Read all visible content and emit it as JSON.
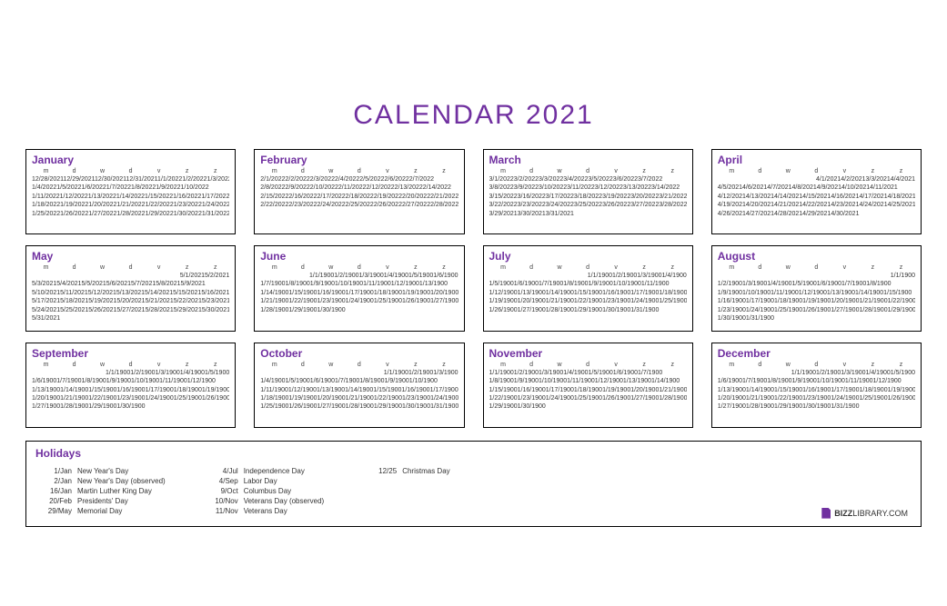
{
  "title": "CALENDAR 2021",
  "dayHeaders": [
    "m",
    "d",
    "w",
    "d",
    "v",
    "z",
    "z"
  ],
  "months": [
    {
      "name": "January",
      "rows": [
        "12/28/202112/29/202112/30/202112/31/20211/1/20221/2/20221/3/2022",
        "1/4/20221/5/20221/6/20221/7/20221/8/20221/9/20221/10/2022",
        "1/11/20221/12/20221/13/20221/14/20221/15/20221/16/20221/17/2022",
        "1/18/20221/19/20221/20/20221/21/20221/22/20221/23/20221/24/2022",
        "1/25/20221/26/20221/27/20221/28/20221/29/20221/30/20221/31/2022"
      ]
    },
    {
      "name": "February",
      "rows": [
        "2/1/20222/2/20222/3/20222/4/20222/5/20222/6/20222/7/2022",
        "2/8/20222/9/20222/10/20222/11/20222/12/20222/13/20222/14/2022",
        "2/15/20222/16/20222/17/20222/18/20222/19/20222/20/20222/21/2022",
        "2/22/20222/23/20222/24/20222/25/20222/26/20222/27/20222/28/2022"
      ]
    },
    {
      "name": "March",
      "rows": [
        "3/1/20223/2/20223/3/20223/4/20223/5/20223/6/20223/7/2022",
        "3/8/20223/9/20223/10/20223/11/20223/12/20223/13/20223/14/2022",
        "3/15/20223/16/20223/17/20223/18/20223/19/20223/20/20223/21/2022",
        "3/22/20223/23/20223/24/20223/25/20223/26/20223/27/20223/28/2022",
        "3/29/20213/30/20213/31/2021"
      ]
    },
    {
      "name": "April",
      "rows": [
        "4/1/20214/2/20213/3/20214/4/2021",
        "4/5/20214/6/20214/7/20214/8/20214/9/20214/10/20214/11/2021",
        "4/12/20214/13/20214/14/20214/15/20214/16/20214/17/20214/18/2021",
        "4/19/20214/20/20214/21/20214/22/20214/23/20214/24/20214/25/2021",
        "4/26/20214/27/20214/28/20214/29/20214/30/2021"
      ],
      "firstRowOffset": 3
    },
    {
      "name": "May",
      "rows": [
        "5/1/20215/2/2021",
        "5/3/20215/4/20215/5/20215/6/20215/7/20215/8/20215/9/2021",
        "5/10/20215/11/20215/12/20215/13/20215/14/20215/15/20215/16/2021",
        "5/17/20215/18/20215/19/20215/20/20215/21/20215/22/20215/23/2021",
        "5/24/20215/25/20215/26/20215/27/20215/28/20215/29/20215/30/2021",
        "5/31/2021"
      ],
      "firstRowOffset": 5
    },
    {
      "name": "June",
      "rows": [
        "1/1/19001/2/19001/3/19001/4/19001/5/19001/6/1900",
        "1/7/19001/8/19001/9/19001/10/19001/11/19001/12/19001/13/1900",
        "1/14/19001/15/19001/16/19001/17/19001/18/19001/19/19001/20/1900",
        "1/21/19001/22/19001/23/19001/24/19001/25/19001/26/19001/27/1900",
        "1/28/19001/29/19001/30/1900"
      ],
      "firstRowOffset": 1
    },
    {
      "name": "July",
      "rows": [
        "1/1/19001/2/19001/3/19001/4/1900",
        "1/5/19001/6/19001/7/19001/8/19001/9/19001/10/19001/11/1900",
        "1/12/19001/13/19001/14/19001/15/19001/16/19001/17/19001/18/1900",
        "1/19/19001/20/19001/21/19001/22/19001/23/19001/24/19001/25/1900",
        "1/26/19001/27/19001/28/19001/29/19001/30/19001/31/1900"
      ],
      "firstRowOffset": 3
    },
    {
      "name": "August",
      "rows": [
        "1/1/1900",
        "1/2/19001/3/19001/4/19001/5/19001/6/19001/7/19001/8/1900",
        "1/9/19001/10/19001/11/19001/12/19001/13/19001/14/19001/15/1900",
        "1/16/19001/17/19001/18/19001/19/19001/20/19001/21/19001/22/1900",
        "1/23/19001/24/19001/25/19001/26/19001/27/19001/28/19001/29/1900",
        "1/30/19001/31/1900"
      ],
      "firstRowOffset": 6
    },
    {
      "name": "September",
      "rows": [
        "1/1/19001/2/19001/3/19001/4/19001/5/1900",
        "1/6/19001/7/19001/8/19001/9/19001/10/19001/11/19001/12/1900",
        "1/13/19001/14/19001/15/19001/16/19001/17/19001/18/19001/19/1900",
        "1/20/19001/21/19001/22/19001/23/19001/24/19001/25/19001/26/1900",
        "1/27/19001/28/19001/29/19001/30/1900"
      ],
      "firstRowOffset": 2
    },
    {
      "name": "October",
      "rows": [
        "1/1/19001/2/19001/3/1900",
        "1/4/19001/5/19001/6/19001/7/19001/8/19001/9/19001/10/1900",
        "1/11/19001/12/19001/13/19001/14/19001/15/19001/16/19001/17/1900",
        "1/18/19001/19/19001/20/19001/21/19001/22/19001/23/19001/24/1900",
        "1/25/19001/26/19001/27/19001/28/19001/29/19001/30/19001/31/1900"
      ],
      "firstRowOffset": 4
    },
    {
      "name": "November",
      "rows": [
        "1/1/19001/2/19001/3/19001/4/19001/5/19001/6/19001/7/1900",
        "1/8/19001/9/19001/10/19001/11/19001/12/19001/13/19001/14/1900",
        "1/15/19001/16/19001/17/19001/18/19001/19/19001/20/19001/21/1900",
        "1/22/19001/23/19001/24/19001/25/19001/26/19001/27/19001/28/1900",
        "1/29/19001/30/1900"
      ]
    },
    {
      "name": "December",
      "rows": [
        "1/1/19001/2/19001/3/19001/4/19001/5/1900",
        "1/6/19001/7/19001/8/19001/9/19001/10/19001/11/19001/12/1900",
        "1/13/19001/14/19001/15/19001/16/19001/17/19001/18/19001/19/1900",
        "1/20/19001/21/19001/22/19001/23/19001/24/19001/25/19001/26/1900",
        "1/27/19001/28/19001/29/19001/30/19001/31/1900"
      ],
      "firstRowOffset": 2
    }
  ],
  "holidaysTitle": "Holidays",
  "holidays": [
    [
      {
        "date": "1/Jan",
        "name": "New Year's Day"
      },
      {
        "date": "2/Jan",
        "name": "New Year's Day (observed)"
      },
      {
        "date": "16/Jan",
        "name": "Martin Luther King Day"
      },
      {
        "date": "20/Feb",
        "name": "Presidents' Day"
      },
      {
        "date": "29/May",
        "name": "Memorial Day"
      }
    ],
    [
      {
        "date": "4/Jul",
        "name": "Independence Day"
      },
      {
        "date": "4/Sep",
        "name": "Labor Day"
      },
      {
        "date": "9/Oct",
        "name": "Columbus Day"
      },
      {
        "date": "10/Nov",
        "name": "Veterans Day (observed)"
      },
      {
        "date": "11/Nov",
        "name": "Veterans Day"
      }
    ],
    [
      {
        "date": "12/25",
        "name": "Christmas Day"
      }
    ]
  ],
  "logo": {
    "bold": "BIZZ",
    "rest": "LIBRARY.COM"
  }
}
